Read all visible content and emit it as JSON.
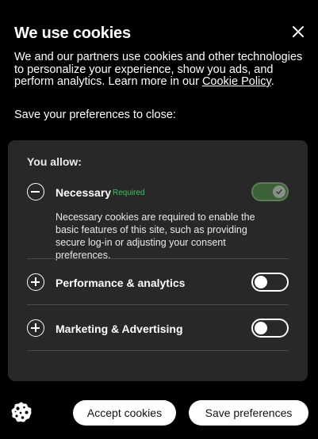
{
  "header": {
    "title": "We use cookies"
  },
  "intro": {
    "text": "We and our partners use cookies and other technologies to personalize your experience, show you ads, and perform analytics. Learn more in our ",
    "link": "Cookie Policy",
    "end": "."
  },
  "save_prompt": "Save your preferences to close:",
  "panel": {
    "heading": "You allow:",
    "sections": [
      {
        "label": "Necessary",
        "badge": "Required",
        "expanded": true,
        "enabled": true,
        "locked": true,
        "description": "Necessary cookies are required to enable the basic features of this site, such as providing secure log-in or adjusting your consent preferences."
      },
      {
        "label": "Performance & analytics",
        "expanded": false,
        "enabled": false
      },
      {
        "label": "Marketing & Advertising",
        "expanded": false,
        "enabled": false
      }
    ]
  },
  "footer": {
    "accept_label": "Accept cookies",
    "save_label": "Save preferences"
  },
  "icons": {
    "close": "close-icon",
    "cookie": "cookie-icon",
    "check": "check-icon"
  },
  "colors": {
    "background": "#000000",
    "panel": "#282828",
    "required": "#3ec15b"
  }
}
